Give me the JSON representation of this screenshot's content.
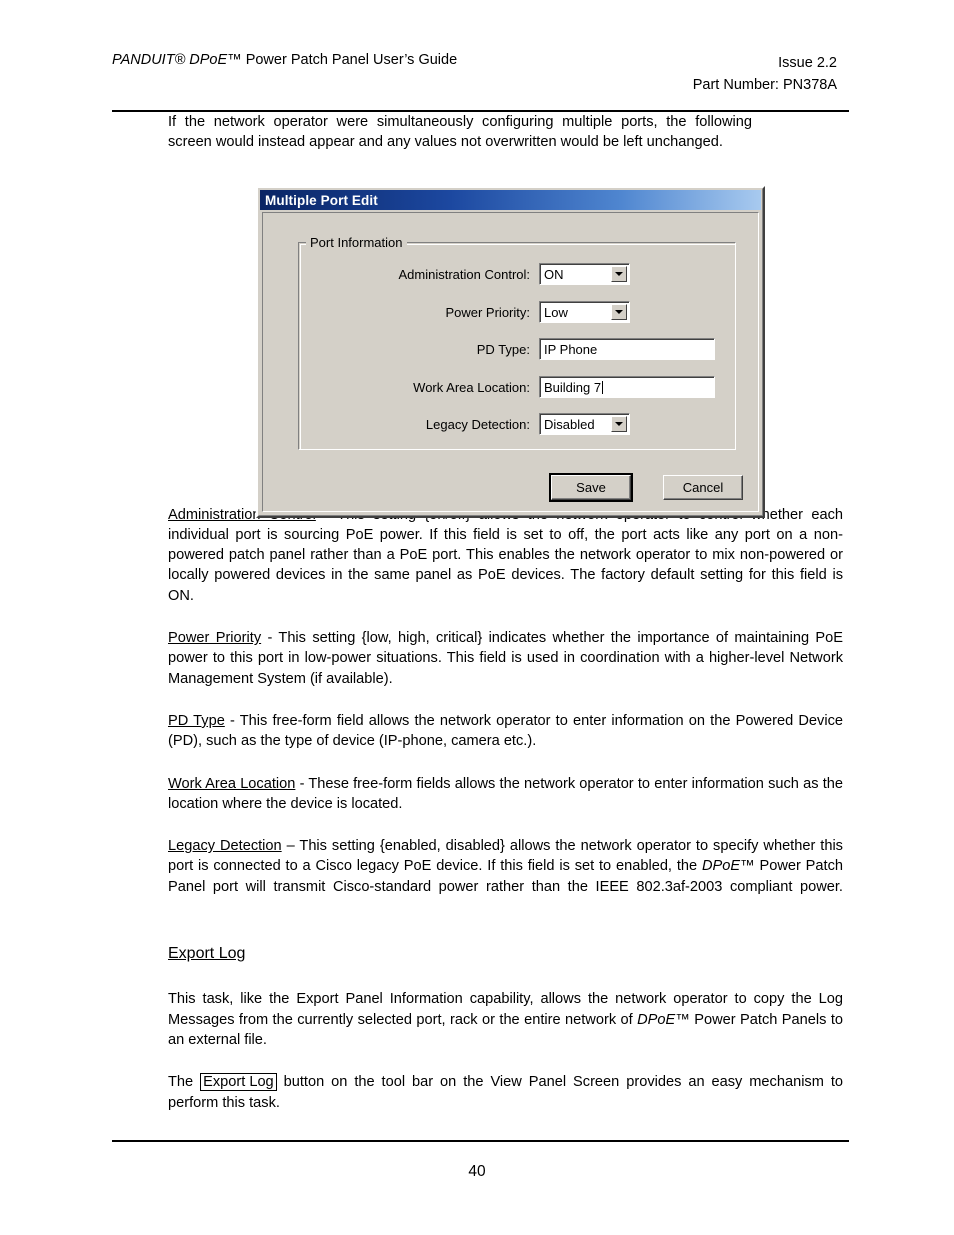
{
  "header": {
    "left_italic": "PANDUIT® DPoE™",
    "left_rest": " Power Patch Panel User’s Guide",
    "right_line1": "Issue 2.2",
    "right_line2": "Part Number: PN378A"
  },
  "footer": {
    "page_number": "40"
  },
  "intro": {
    "text": "If the network operator were simultaneously configuring multiple ports, the following screen would instead appear and any values not overwritten would be left unchanged."
  },
  "dialog": {
    "title": "Multiple Port Edit",
    "groupbox_legend": "Port Information",
    "fields": [
      {
        "label": "Administration Control:",
        "value": "ON",
        "type": "combobox"
      },
      {
        "label": "Power Priority:",
        "value": "Low",
        "type": "combobox"
      },
      {
        "label": "PD Type:",
        "value": "IP Phone",
        "type": "textfield"
      },
      {
        "label": "Work Area Location:",
        "value": "Building 7",
        "type": "textfield",
        "has_caret": true
      },
      {
        "label": "Legacy Detection:",
        "value": "Disabled",
        "type": "combobox"
      }
    ],
    "buttons": {
      "save": "Save",
      "cancel": "Cancel"
    },
    "colors": {
      "face": "#d4d0c8",
      "titlebar_start": "#0a2464",
      "titlebar_end": "#a8caef",
      "field_background": "#ffffff"
    }
  },
  "definitions": [
    {
      "term": "Administration Control",
      "dash": " - ",
      "body": "This setting {on/off} allows the network operator to control whether each individual port is sourcing PoE power.  If this field is set to off, the port acts like any port on a non-powered patch panel rather than a PoE port. This enables the network operator to mix non-powered or locally powered devices in the same panel as PoE devices. The factory default setting for this field is ON."
    },
    {
      "term": "Power Priority",
      "dash": " - ",
      "body": "This setting {low, high, critical} indicates whether the importance of maintaining PoE power to this port in low-power situations.  This field is used in coordination with a higher-level Network Management System (if available)."
    },
    {
      "term": "PD Type",
      "dash": " - ",
      "body": "This free-form field allows the network operator to enter information on the Powered Device (PD), such as the type of device (IP-phone, camera etc.)."
    },
    {
      "term": "Work Area Location",
      "dash": " - ",
      "body": "These free-form fields allows the network operator to enter information such as the location where the device is located."
    }
  ],
  "legacy_detection": {
    "term": "Legacy Detection",
    "dash": " – ",
    "body_part1": "This setting {enabled, disabled} allows the network operator to specify whether this port is connected to a Cisco legacy PoE device.  If this field is set to enabled, the ",
    "italic_run": "DPoE™",
    "body_part2": " Power Patch Panel port will transmit Cisco-standard power rather than the IEEE 802.3af-2003 compliant power."
  },
  "export_log": {
    "heading": "Export Log",
    "para1_part1": "This task, like the Export Panel Information capability, allows the network operator to copy the Log Messages from the currently selected port, rack or the entire network of ",
    "para1_italic": "DPoE™",
    "para1_part2": " Power Patch Panels to an external file.",
    "para2_part1": "The ",
    "para2_boxed": "Export Log",
    "para2_part2": " button on the tool bar on the View Panel Screen provides an easy mechanism to perform this task."
  }
}
